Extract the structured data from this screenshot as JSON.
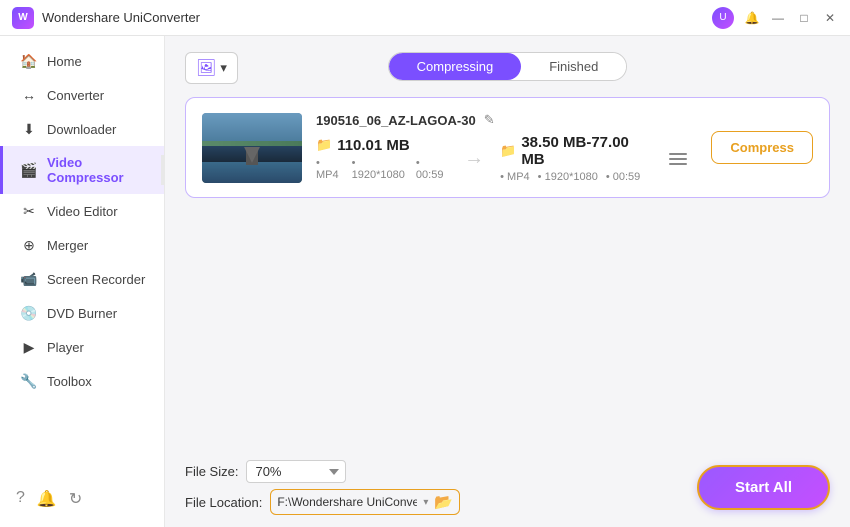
{
  "titleBar": {
    "appName": "Wondershare UniConverter",
    "appIconText": "W",
    "buttons": {
      "minimize": "—",
      "maximize": "□",
      "close": "✕"
    }
  },
  "sidebar": {
    "items": [
      {
        "id": "home",
        "label": "Home",
        "icon": "🏠",
        "active": false
      },
      {
        "id": "converter",
        "label": "Converter",
        "icon": "↔",
        "active": false
      },
      {
        "id": "downloader",
        "label": "Downloader",
        "icon": "⬇",
        "active": false
      },
      {
        "id": "video-compressor",
        "label": "Video Compressor",
        "icon": "🎬",
        "active": true
      },
      {
        "id": "video-editor",
        "label": "Video Editor",
        "icon": "✂",
        "active": false
      },
      {
        "id": "merger",
        "label": "Merger",
        "icon": "⊕",
        "active": false
      },
      {
        "id": "screen-recorder",
        "label": "Screen Recorder",
        "icon": "📹",
        "active": false
      },
      {
        "id": "dvd-burner",
        "label": "DVD Burner",
        "icon": "💿",
        "active": false
      },
      {
        "id": "player",
        "label": "Player",
        "icon": "▶",
        "active": false
      },
      {
        "id": "toolbox",
        "label": "Toolbox",
        "icon": "🔧",
        "active": false
      }
    ],
    "footer": {
      "icons": [
        "?",
        "🔔",
        "↻"
      ]
    }
  },
  "tabs": {
    "items": [
      {
        "id": "compressing",
        "label": "Compressing",
        "active": true
      },
      {
        "id": "finished",
        "label": "Finished",
        "active": false
      }
    ]
  },
  "addButton": {
    "label": "Add Files",
    "dropdownIcon": "▾"
  },
  "fileCard": {
    "name": "190516_06_AZ-LAGOA-30",
    "editIcon": "✎",
    "source": {
      "size": "110.01 MB",
      "format": "MP4",
      "resolution": "1920*1080",
      "duration": "00:59"
    },
    "target": {
      "size": "38.50 MB-77.00 MB",
      "format": "MP4",
      "resolution": "1920*1080",
      "duration": "00:59"
    },
    "compressButton": "Compress"
  },
  "bottomBar": {
    "fileSizeLabel": "File Size:",
    "fileSizeValue": "70%",
    "fileLocationLabel": "File Location:",
    "fileLocationValue": "F:\\Wondershare UniConverte",
    "startAllLabel": "Start All"
  }
}
